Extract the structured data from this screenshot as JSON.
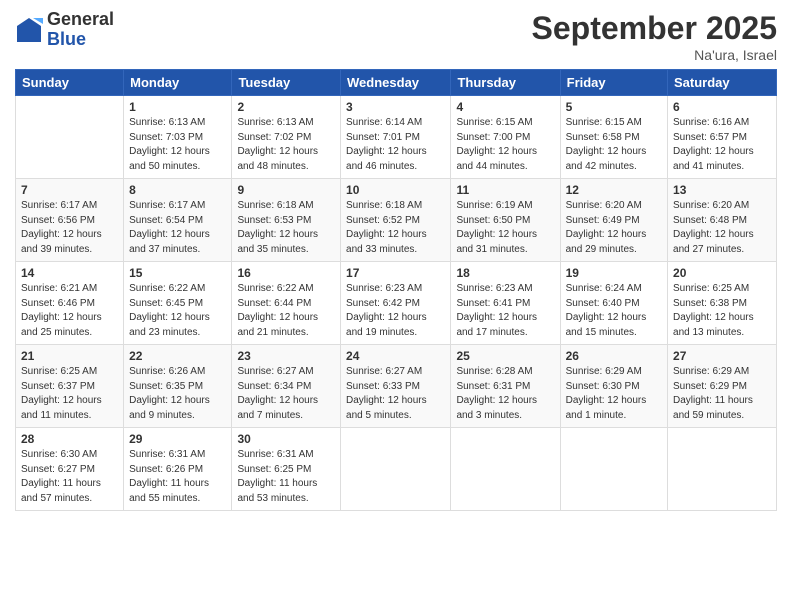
{
  "header": {
    "logo_general": "General",
    "logo_blue": "Blue",
    "month_title": "September 2025",
    "location": "Na'ura, Israel"
  },
  "weekdays": [
    "Sunday",
    "Monday",
    "Tuesday",
    "Wednesday",
    "Thursday",
    "Friday",
    "Saturday"
  ],
  "weeks": [
    [
      {
        "day": "",
        "info": ""
      },
      {
        "day": "1",
        "info": "Sunrise: 6:13 AM\nSunset: 7:03 PM\nDaylight: 12 hours\nand 50 minutes."
      },
      {
        "day": "2",
        "info": "Sunrise: 6:13 AM\nSunset: 7:02 PM\nDaylight: 12 hours\nand 48 minutes."
      },
      {
        "day": "3",
        "info": "Sunrise: 6:14 AM\nSunset: 7:01 PM\nDaylight: 12 hours\nand 46 minutes."
      },
      {
        "day": "4",
        "info": "Sunrise: 6:15 AM\nSunset: 7:00 PM\nDaylight: 12 hours\nand 44 minutes."
      },
      {
        "day": "5",
        "info": "Sunrise: 6:15 AM\nSunset: 6:58 PM\nDaylight: 12 hours\nand 42 minutes."
      },
      {
        "day": "6",
        "info": "Sunrise: 6:16 AM\nSunset: 6:57 PM\nDaylight: 12 hours\nand 41 minutes."
      }
    ],
    [
      {
        "day": "7",
        "info": "Sunrise: 6:17 AM\nSunset: 6:56 PM\nDaylight: 12 hours\nand 39 minutes."
      },
      {
        "day": "8",
        "info": "Sunrise: 6:17 AM\nSunset: 6:54 PM\nDaylight: 12 hours\nand 37 minutes."
      },
      {
        "day": "9",
        "info": "Sunrise: 6:18 AM\nSunset: 6:53 PM\nDaylight: 12 hours\nand 35 minutes."
      },
      {
        "day": "10",
        "info": "Sunrise: 6:18 AM\nSunset: 6:52 PM\nDaylight: 12 hours\nand 33 minutes."
      },
      {
        "day": "11",
        "info": "Sunrise: 6:19 AM\nSunset: 6:50 PM\nDaylight: 12 hours\nand 31 minutes."
      },
      {
        "day": "12",
        "info": "Sunrise: 6:20 AM\nSunset: 6:49 PM\nDaylight: 12 hours\nand 29 minutes."
      },
      {
        "day": "13",
        "info": "Sunrise: 6:20 AM\nSunset: 6:48 PM\nDaylight: 12 hours\nand 27 minutes."
      }
    ],
    [
      {
        "day": "14",
        "info": "Sunrise: 6:21 AM\nSunset: 6:46 PM\nDaylight: 12 hours\nand 25 minutes."
      },
      {
        "day": "15",
        "info": "Sunrise: 6:22 AM\nSunset: 6:45 PM\nDaylight: 12 hours\nand 23 minutes."
      },
      {
        "day": "16",
        "info": "Sunrise: 6:22 AM\nSunset: 6:44 PM\nDaylight: 12 hours\nand 21 minutes."
      },
      {
        "day": "17",
        "info": "Sunrise: 6:23 AM\nSunset: 6:42 PM\nDaylight: 12 hours\nand 19 minutes."
      },
      {
        "day": "18",
        "info": "Sunrise: 6:23 AM\nSunset: 6:41 PM\nDaylight: 12 hours\nand 17 minutes."
      },
      {
        "day": "19",
        "info": "Sunrise: 6:24 AM\nSunset: 6:40 PM\nDaylight: 12 hours\nand 15 minutes."
      },
      {
        "day": "20",
        "info": "Sunrise: 6:25 AM\nSunset: 6:38 PM\nDaylight: 12 hours\nand 13 minutes."
      }
    ],
    [
      {
        "day": "21",
        "info": "Sunrise: 6:25 AM\nSunset: 6:37 PM\nDaylight: 12 hours\nand 11 minutes."
      },
      {
        "day": "22",
        "info": "Sunrise: 6:26 AM\nSunset: 6:35 PM\nDaylight: 12 hours\nand 9 minutes."
      },
      {
        "day": "23",
        "info": "Sunrise: 6:27 AM\nSunset: 6:34 PM\nDaylight: 12 hours\nand 7 minutes."
      },
      {
        "day": "24",
        "info": "Sunrise: 6:27 AM\nSunset: 6:33 PM\nDaylight: 12 hours\nand 5 minutes."
      },
      {
        "day": "25",
        "info": "Sunrise: 6:28 AM\nSunset: 6:31 PM\nDaylight: 12 hours\nand 3 minutes."
      },
      {
        "day": "26",
        "info": "Sunrise: 6:29 AM\nSunset: 6:30 PM\nDaylight: 12 hours\nand 1 minute."
      },
      {
        "day": "27",
        "info": "Sunrise: 6:29 AM\nSunset: 6:29 PM\nDaylight: 11 hours\nand 59 minutes."
      }
    ],
    [
      {
        "day": "28",
        "info": "Sunrise: 6:30 AM\nSunset: 6:27 PM\nDaylight: 11 hours\nand 57 minutes."
      },
      {
        "day": "29",
        "info": "Sunrise: 6:31 AM\nSunset: 6:26 PM\nDaylight: 11 hours\nand 55 minutes."
      },
      {
        "day": "30",
        "info": "Sunrise: 6:31 AM\nSunset: 6:25 PM\nDaylight: 11 hours\nand 53 minutes."
      },
      {
        "day": "",
        "info": ""
      },
      {
        "day": "",
        "info": ""
      },
      {
        "day": "",
        "info": ""
      },
      {
        "day": "",
        "info": ""
      }
    ]
  ]
}
